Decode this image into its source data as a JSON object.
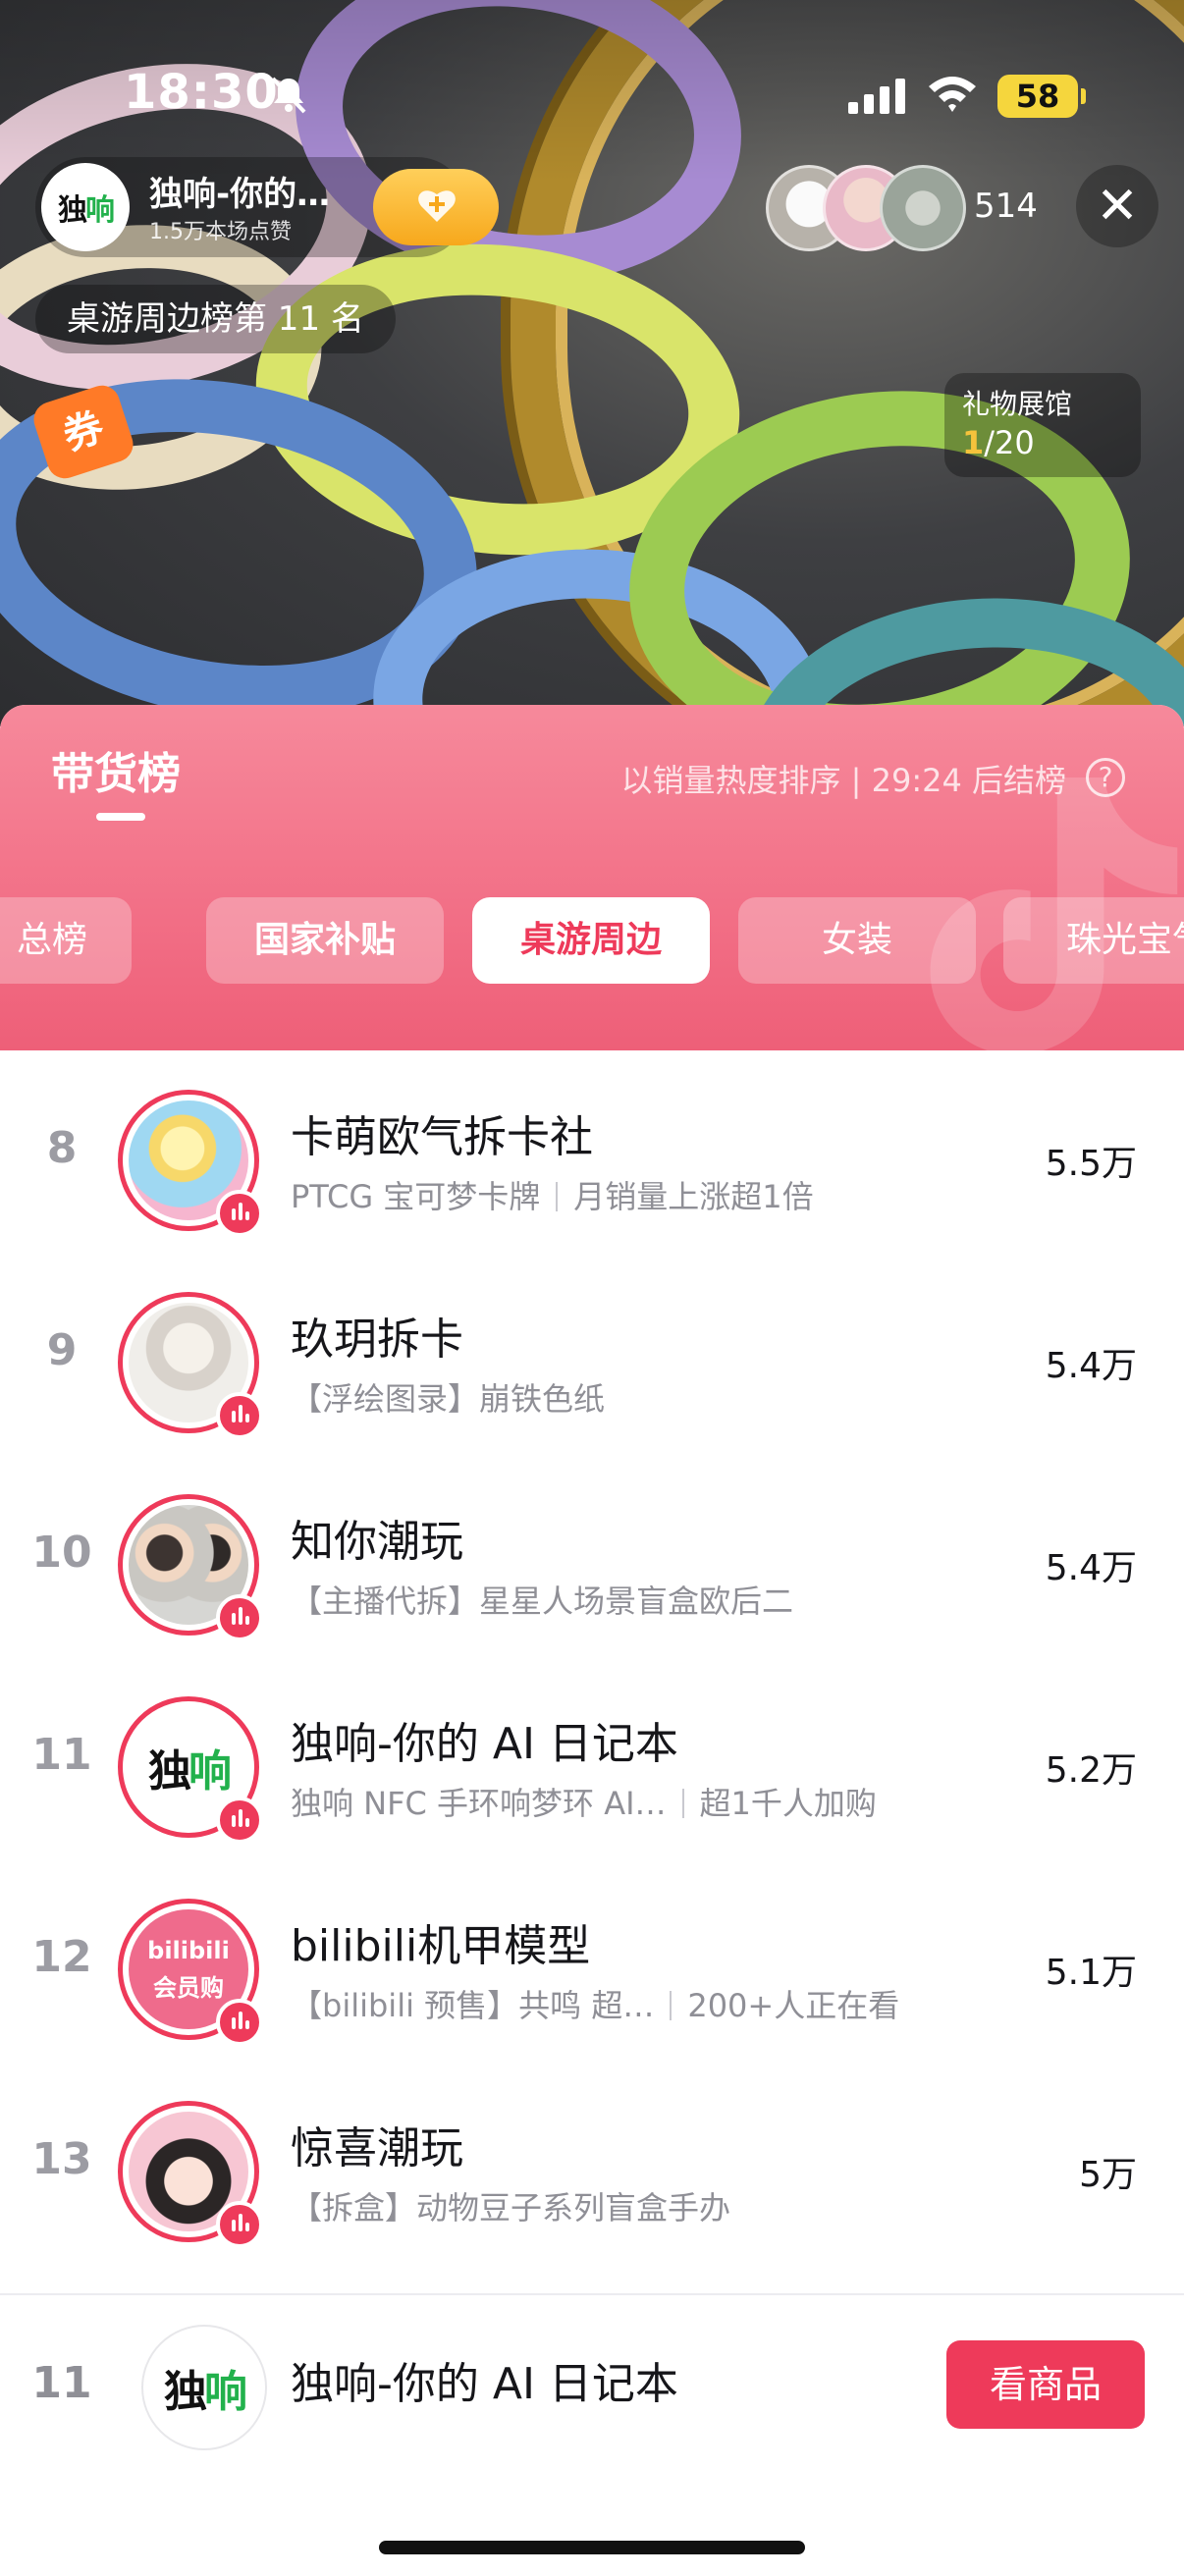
{
  "status_bar": {
    "time": "18:30",
    "battery": "58"
  },
  "live": {
    "host_name": "独响-你的…",
    "host_likes": "1.5万本场点赞",
    "viewer_count": "514",
    "category_rank": "桌游周边榜第 11 名",
    "coupon_label": "券",
    "gift_hall_title": "礼物展馆",
    "gift_hall_current": "1",
    "gift_hall_total": "/20"
  },
  "board": {
    "title": "带货榜",
    "sort_info": "以销量热度排序 | 29:24 后结榜",
    "help": "?",
    "tabs": [
      {
        "label": "总榜"
      },
      {
        "label": "国家补贴"
      },
      {
        "label": "桌游周边"
      },
      {
        "label": "女装"
      },
      {
        "label": "珠光宝气"
      }
    ],
    "active_tab": "桌游周边"
  },
  "list": [
    {
      "rank": "8",
      "name": "卡萌欧气拆卡社",
      "sub1": "PTCG 宝可梦卡牌",
      "sub2": "月销量上涨超1倍",
      "sales": "5.5万"
    },
    {
      "rank": "9",
      "name": "玖玥拆卡",
      "sub1": "【浮绘图录】崩铁色纸",
      "sub2": "",
      "sales": "5.4万"
    },
    {
      "rank": "10",
      "name": "知你潮玩",
      "sub1": "【主播代拆】星星人场景盲盒欧后二",
      "sub2": "",
      "sales": "5.4万"
    },
    {
      "rank": "11",
      "name": "独响-你的 AI 日记本",
      "sub1": "独响 NFC 手环响梦环 AI…",
      "sub2": "超1千人加购",
      "sales": "5.2万"
    },
    {
      "rank": "12",
      "name": "bilibili机甲模型",
      "sub1": "【bilibili 预售】共鸣 超…",
      "sub2": "200+人正在看",
      "sales": "5.1万"
    },
    {
      "rank": "13",
      "name": "惊喜潮玩",
      "sub1": "【拆盒】动物豆子系列盲盒手办",
      "sub2": "",
      "sales": "5万"
    }
  ],
  "self_row": {
    "rank": "11",
    "name": "独响-你的 AI 日记本",
    "cta": "看商品"
  },
  "logo_text": {
    "left": "独",
    "right": "响"
  },
  "bilibili_avatar_text": {
    "top": "bilibili",
    "bottom": "会员购"
  },
  "colors": {
    "accent": "#ee3a5a",
    "pink_top": "#f6899b",
    "pink_bottom": "#ee5f78"
  }
}
